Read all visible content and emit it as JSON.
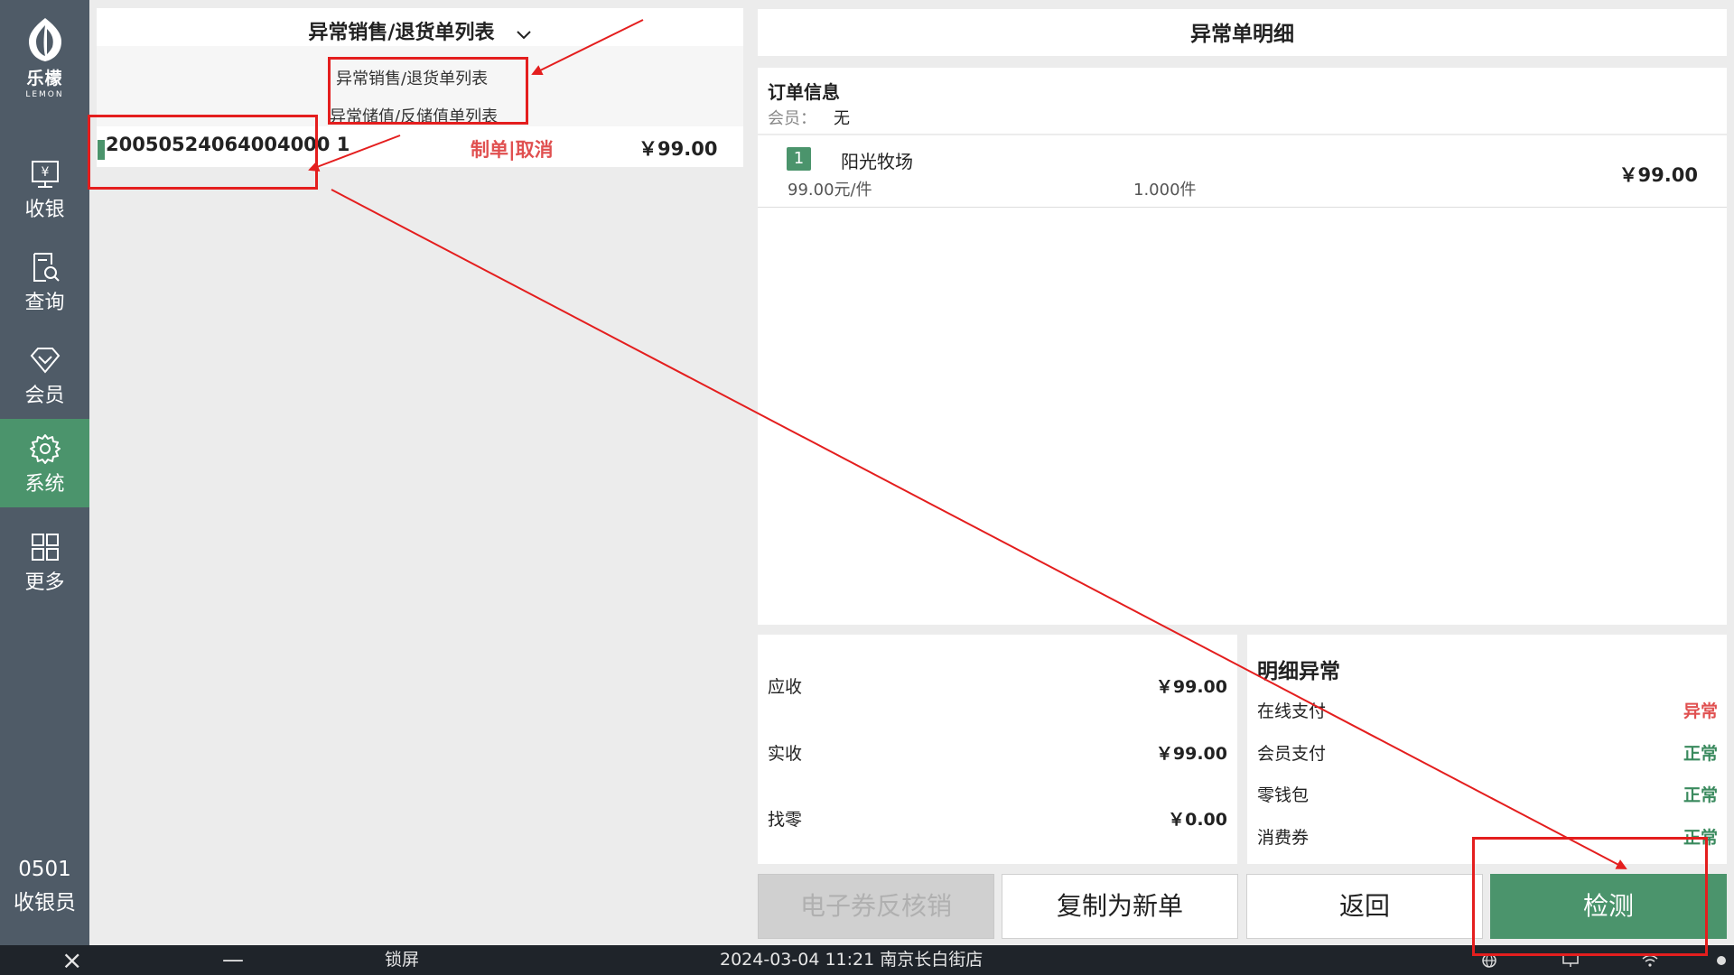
{
  "sidebar": {
    "logo": {
      "cn": "乐檬",
      "en": "LEMON"
    },
    "items": [
      {
        "label": "收银",
        "icon": "cashier-icon"
      },
      {
        "label": "查询",
        "icon": "search-doc-icon"
      },
      {
        "label": "会员",
        "icon": "diamond-icon"
      },
      {
        "label": "系统",
        "icon": "gear-icon",
        "active": true
      },
      {
        "label": "更多",
        "icon": "grid-icon"
      }
    ],
    "operator": {
      "id": "0501",
      "role": "收银员"
    }
  },
  "left_panel": {
    "title": "异常销售/退货单列表",
    "dropdown_options": [
      "异常销售/退货单列表",
      "异常储值/反储值单列表"
    ],
    "orders": [
      {
        "order_no": "20050524064004000 1",
        "status": "制单|取消",
        "amount": "￥99.00"
      }
    ]
  },
  "right_panel": {
    "title": "异常单明细",
    "order_info": {
      "title": "订单信息",
      "member_label": "会员：",
      "member_value": "无"
    },
    "items": [
      {
        "index": "1",
        "name": "阳光牧场",
        "unit_price": "99.00元/件",
        "qty": "1.000件",
        "amount": "￥99.00"
      }
    ],
    "summary": [
      {
        "label": "应收",
        "value": "￥99.00"
      },
      {
        "label": "实收",
        "value": "￥99.00"
      },
      {
        "label": "找零",
        "value": "￥0.00"
      }
    ],
    "exceptions": {
      "title": "明细异常",
      "rows": [
        {
          "label": "在线支付",
          "status": "异常",
          "color": "#e05050"
        },
        {
          "label": "会员支付",
          "status": "正常",
          "color": "#3a8a5e"
        },
        {
          "label": "零钱包",
          "status": "正常",
          "color": "#3a8a5e"
        },
        {
          "label": "消费券",
          "status": "正常",
          "color": "#3a8a5e"
        }
      ]
    },
    "buttons": {
      "e_coupon_reverse": "电子券反核销",
      "copy_new": "复制为新单",
      "back": "返回",
      "check": "检测"
    }
  },
  "taskbar": {
    "lock": "锁屏",
    "datetime_store": "2024-03-04 11:21  南京长白街店"
  },
  "colors": {
    "sidebar_bg": "#4f5b67",
    "accent_green": "#4b946c",
    "danger_red": "#e05050",
    "annotation_red": "#e41e1e"
  }
}
